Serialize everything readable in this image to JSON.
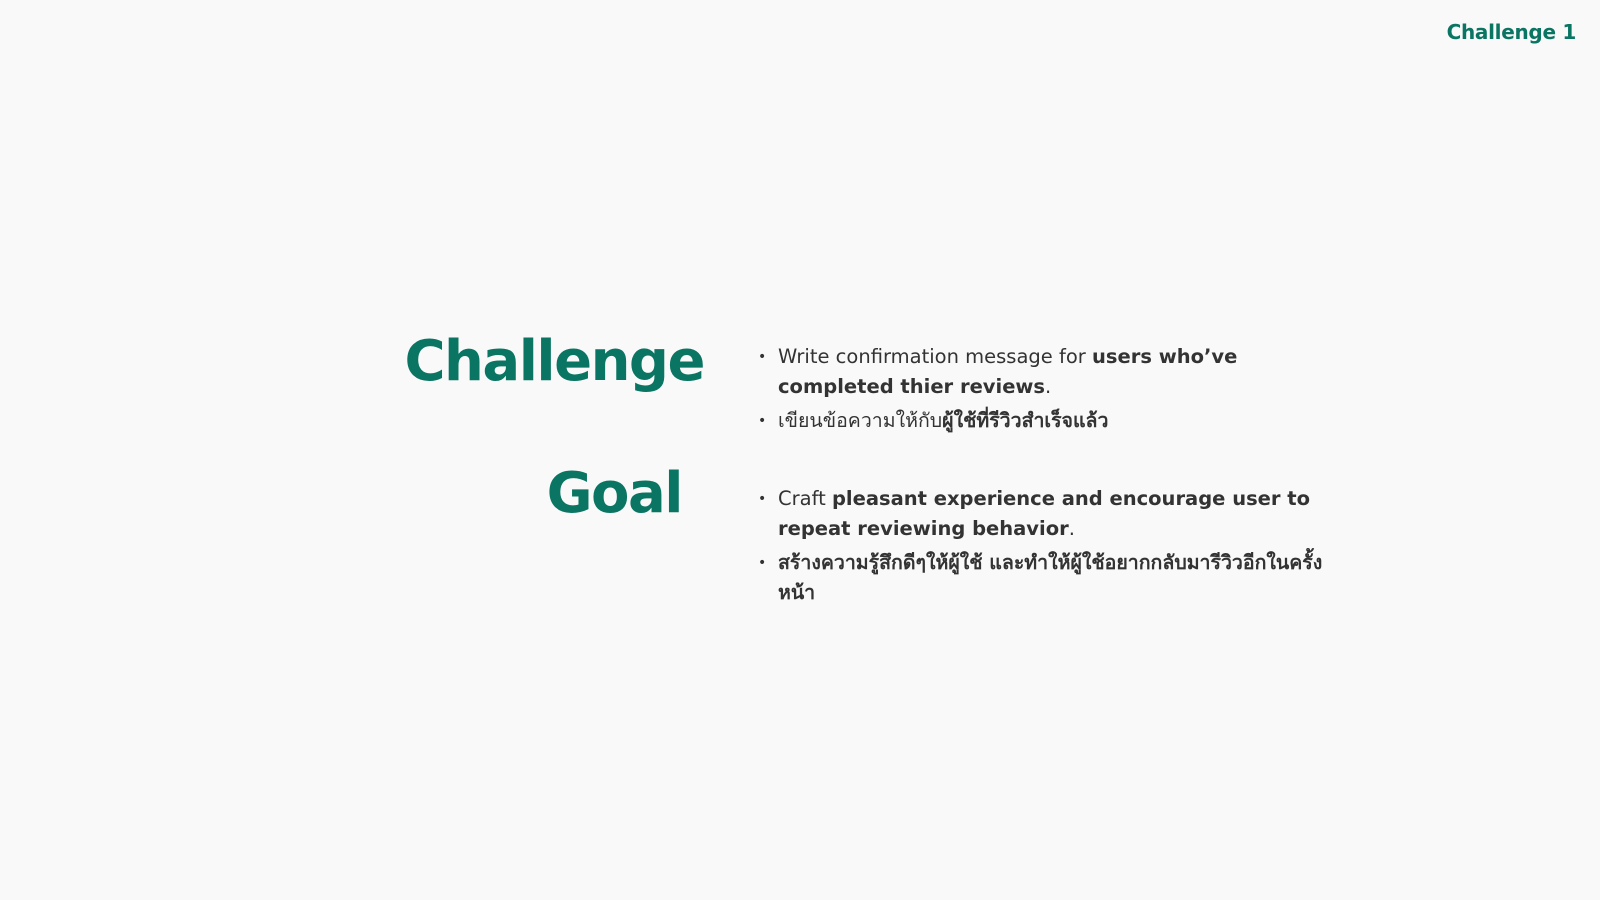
{
  "header": {
    "corner_label": "Challenge 1"
  },
  "colors": {
    "accent": "#0a7562",
    "text": "#333333",
    "background": "#f9f9f9"
  },
  "challenge": {
    "heading": "Challenge",
    "bullets": [
      {
        "plain_prefix": "Write confirmation message for ",
        "bold": "users who’ve completed thier reviews",
        "plain_suffix": "."
      },
      {
        "plain_prefix": "เขียนข้อความให้กับ",
        "bold": "ผู้ใช้ที่รีวิวสำเร็จแล้ว",
        "plain_suffix": ""
      }
    ]
  },
  "goal": {
    "heading": "Goal",
    "bullets": [
      {
        "plain_prefix": "Craft ",
        "bold": "pleasant experience and encourage user to repeat reviewing behavior",
        "plain_suffix": "."
      },
      {
        "plain_prefix": "",
        "bold": "สร้างความรู้สึกดีๆให้ผู้ใช้ และทำให้ผู้ใช้อยากกลับมารีวิวอีกในครั้งหน้า",
        "plain_suffix": ""
      }
    ]
  }
}
